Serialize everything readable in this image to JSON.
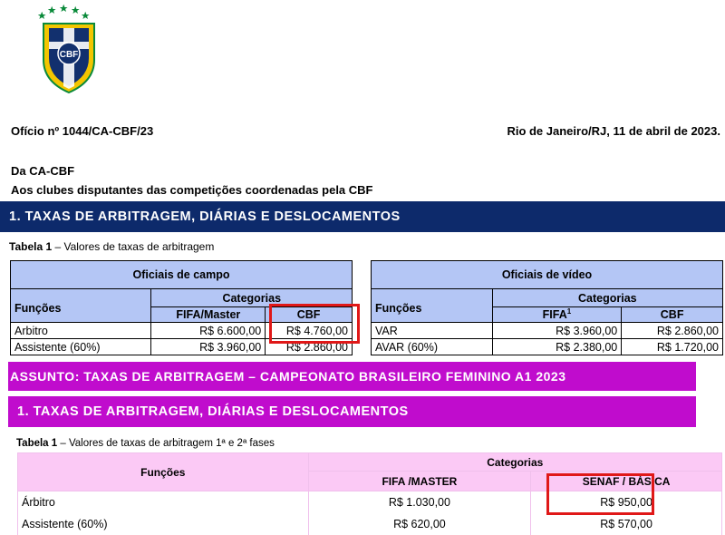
{
  "logo": {
    "text": "CBF",
    "stars": 5
  },
  "header": {
    "oficio": "Ofício nº 1044/CA-CBF/23",
    "local_data": "Rio de Janeiro/RJ, 11 de abril de 2023.",
    "from": "Da CA-CBF",
    "to": "Aos clubes disputantes das competições coordenadas pela CBF"
  },
  "section1": {
    "title": "1.  TAXAS DE ARBITRAGEM, DIÁRIAS E DESLOCAMENTOS"
  },
  "table1_caption": {
    "label": "Tabela 1",
    "text": " – Valores de taxas de arbitragem"
  },
  "campo": {
    "title": "Oficiais de campo",
    "funcoes": "Funções",
    "categorias": "Categorias",
    "col1": "FIFA/Master",
    "col2": "CBF",
    "rows": [
      {
        "funcao": "Arbitro",
        "v1": "R$ 6.600,00",
        "v2": "R$ 4.760,00"
      },
      {
        "funcao": "Assistente (60%)",
        "v1": "R$ 3.960,00",
        "v2": "R$ 2.860,00"
      }
    ]
  },
  "video": {
    "title": "Oficiais de vídeo",
    "funcoes": "Funções",
    "categorias": "Categorias",
    "col1": "FIFA",
    "col1_sup": "1",
    "col2": "CBF",
    "rows": [
      {
        "funcao": "VAR",
        "v1": "R$ 3.960,00",
        "v2": "R$ 2.860,00"
      },
      {
        "funcao": "AVAR (60%)",
        "v1": "R$ 2.380,00",
        "v2": "R$ 1.720,00"
      }
    ]
  },
  "subject": {
    "text": "ASSUNTO: TAXAS DE ARBITRAGEM – CAMPEONATO BRASILEIRO FEMININO A1 2023"
  },
  "section2": {
    "title": "1.  TAXAS DE ARBITRAGEM, DIÁRIAS E DESLOCAMENTOS"
  },
  "table2_caption": {
    "label": "Tabela 1",
    "text": " – Valores de taxas de arbitragem 1ª e 2ª fases"
  },
  "feminino": {
    "funcoes": "Funções",
    "categorias": "Categorias",
    "col1": "FIFA /MASTER",
    "col2": "SENAF / BÁSICA",
    "rows": [
      {
        "funcao": "Árbitro",
        "v1": "R$ 1.030,00",
        "v2": "R$ 950,00"
      },
      {
        "funcao": "Assistente (60%)",
        "v1": "R$ 620,00",
        "v2": "R$ 570,00"
      }
    ]
  },
  "colors": {
    "navy": "#0d2a6b",
    "magenta": "#c00ccd",
    "table_blue": "#b4c6f5",
    "table_pink": "#fbc9f5",
    "highlight": "#e01818"
  }
}
